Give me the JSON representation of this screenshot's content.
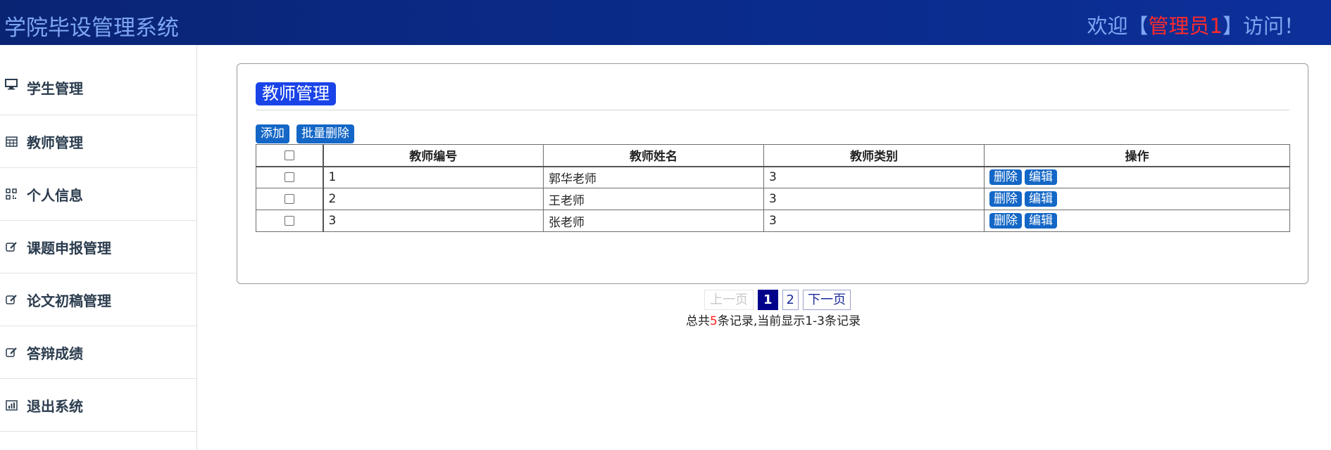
{
  "header": {
    "app_title": "学院毕设管理系统",
    "welcome_prefix": "欢迎【",
    "user_name": "管理员1",
    "welcome_suffix": "】访问！"
  },
  "sidebar": {
    "items": [
      {
        "label": "学生管理",
        "icon": "monitor-icon"
      },
      {
        "label": "教师管理",
        "icon": "table-icon"
      },
      {
        "label": "个人信息",
        "icon": "qrcode-icon"
      },
      {
        "label": "课题申报管理",
        "icon": "edit-icon"
      },
      {
        "label": "论文初稿管理",
        "icon": "edit-icon"
      },
      {
        "label": "答辩成绩",
        "icon": "edit-icon"
      },
      {
        "label": "退出系统",
        "icon": "bar-chart-icon"
      }
    ]
  },
  "main": {
    "title": "教师管理",
    "toolbar": {
      "add_label": "添加",
      "batch_delete_label": "批量删除"
    },
    "table": {
      "headers": [
        "教师编号",
        "教师姓名",
        "教师类别",
        "操作"
      ],
      "rows": [
        {
          "id": "1",
          "name": "郭华老师",
          "category": "3"
        },
        {
          "id": "2",
          "name": "王老师",
          "category": "3"
        },
        {
          "id": "3",
          "name": "张老师",
          "category": "3"
        }
      ],
      "delete_label": "删除",
      "edit_label": "编辑"
    },
    "pagination": {
      "prev_label": "上一页",
      "pages": [
        "1",
        "2"
      ],
      "current": "1",
      "next_label": "下一页",
      "summary_prefix": "总共",
      "total": "5",
      "summary_suffix": "条记录,当前显示1-3条记录"
    }
  },
  "colors": {
    "header_bg": "#0a2a86",
    "title_text": "#7ea6f2",
    "user_highlight": "#ff2a2a",
    "accent_button": "#1467c6",
    "panel_title_bg": "#1a44e8",
    "active_page": "#00008b"
  }
}
